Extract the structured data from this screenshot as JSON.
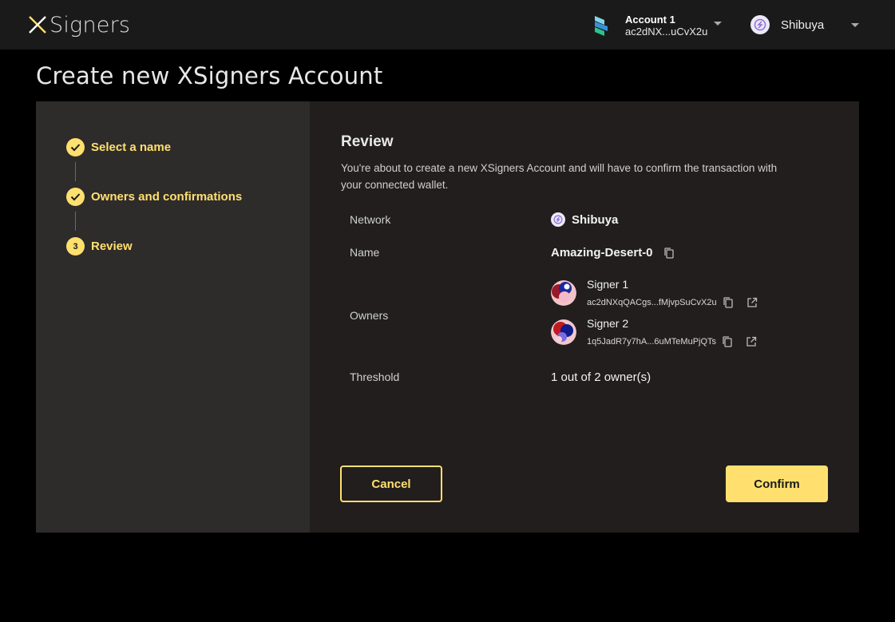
{
  "app": {
    "logo_text": "Signers"
  },
  "header": {
    "account": {
      "name": "Account 1",
      "address": "ac2dNX...uCvX2u"
    },
    "network": {
      "label": "Shibuya"
    }
  },
  "page": {
    "title": "Create new XSigners Account"
  },
  "steps": [
    {
      "number": "1",
      "label": "Select a name",
      "status": "done"
    },
    {
      "number": "2",
      "label": "Owners and confirmations",
      "status": "done"
    },
    {
      "number": "3",
      "label": "Review",
      "status": "current"
    }
  ],
  "review": {
    "title": "Review",
    "description": "You're about to create a new XSigners Account and will have to confirm the transaction with your connected wallet.",
    "network_label": "Network",
    "network_value": "Shibuya",
    "name_label": "Name",
    "name_value": "Amazing-Desert-0",
    "owners_label": "Owners",
    "owners": [
      {
        "name": "Signer 1",
        "address": "ac2dNXqQACgs...fMjvpSuCvX2u"
      },
      {
        "name": "Signer 2",
        "address": "1q5JadR7y7hA...6uMTeMuPjQTs"
      }
    ],
    "threshold_label": "Threshold",
    "threshold_value": "1 out of 2 owner(s)"
  },
  "actions": {
    "cancel_label": "Cancel",
    "confirm_label": "Confirm"
  },
  "colors": {
    "accent": "#ffe06e",
    "steps_bg": "#2e2b2b",
    "review_bg": "#221e1e",
    "topbar_bg": "#1a1a1a"
  }
}
